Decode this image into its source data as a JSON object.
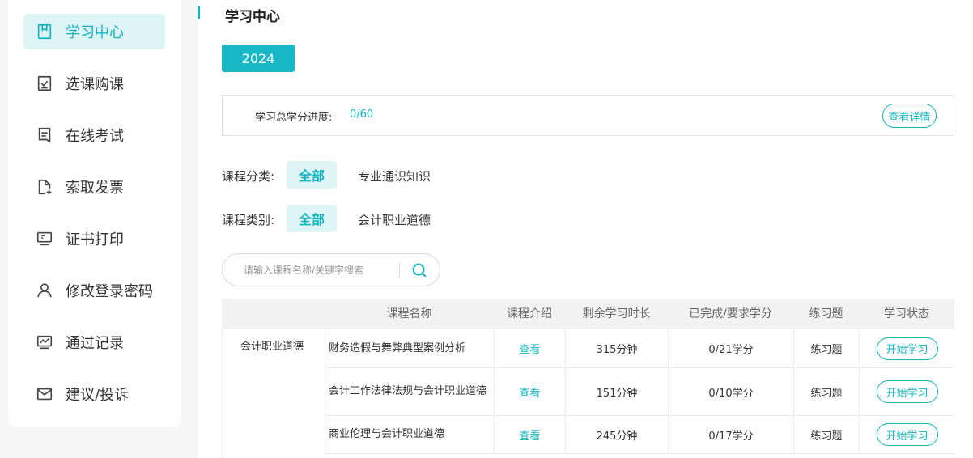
{
  "sidebar": {
    "items": [
      {
        "label": "学习中心",
        "icon": "bookmark-icon",
        "active": true
      },
      {
        "label": "选课购课",
        "icon": "checklist-icon",
        "active": false
      },
      {
        "label": "在线考试",
        "icon": "document-icon",
        "active": false
      },
      {
        "label": "索取发票",
        "icon": "file-add-icon",
        "active": false
      },
      {
        "label": "证书打印",
        "icon": "monitor-icon",
        "active": false
      },
      {
        "label": "修改登录密码",
        "icon": "user-icon",
        "active": false
      },
      {
        "label": "通过记录",
        "icon": "chart-icon",
        "active": false
      },
      {
        "label": "建议/投诉",
        "icon": "mail-icon",
        "active": false
      }
    ]
  },
  "main": {
    "title": "学习中心",
    "year": "2024",
    "progress": {
      "label": "学习总学分进度:",
      "value": "0/60",
      "detail_button": "查看详情"
    },
    "filters": [
      {
        "label": "课程分类:",
        "active": "全部",
        "option": "专业通识知识"
      },
      {
        "label": "课程类别:",
        "active": "全部",
        "option": "会计职业道德"
      }
    ],
    "search": {
      "placeholder": "请输入课程名称/关键字搜索",
      "icon": "search-icon"
    },
    "table": {
      "headers": [
        "课程名称",
        "课程介绍",
        "剩余学习时长",
        "已完成/要求学分",
        "练习题",
        "学习状态"
      ],
      "group": "会计职业道德",
      "rows": [
        {
          "name": "财务造假与舞弊典型案例分析",
          "intro": "查看",
          "remaining": "315分钟",
          "credits": "0/21学分",
          "practice": "练习题",
          "status": "开始学习"
        },
        {
          "name": "会计工作法律法规与会计职业道德",
          "intro": "查看",
          "remaining": "151分钟",
          "credits": "0/10学分",
          "practice": "练习题",
          "status": "开始学习"
        },
        {
          "name": "商业伦理与会计职业道德",
          "intro": "查看",
          "remaining": "245分钟",
          "credits": "0/17学分",
          "practice": "练习题",
          "status": "开始学习"
        }
      ]
    }
  },
  "colors": {
    "accent": "#13b5c1",
    "accent_bg": "#dff4f7"
  }
}
